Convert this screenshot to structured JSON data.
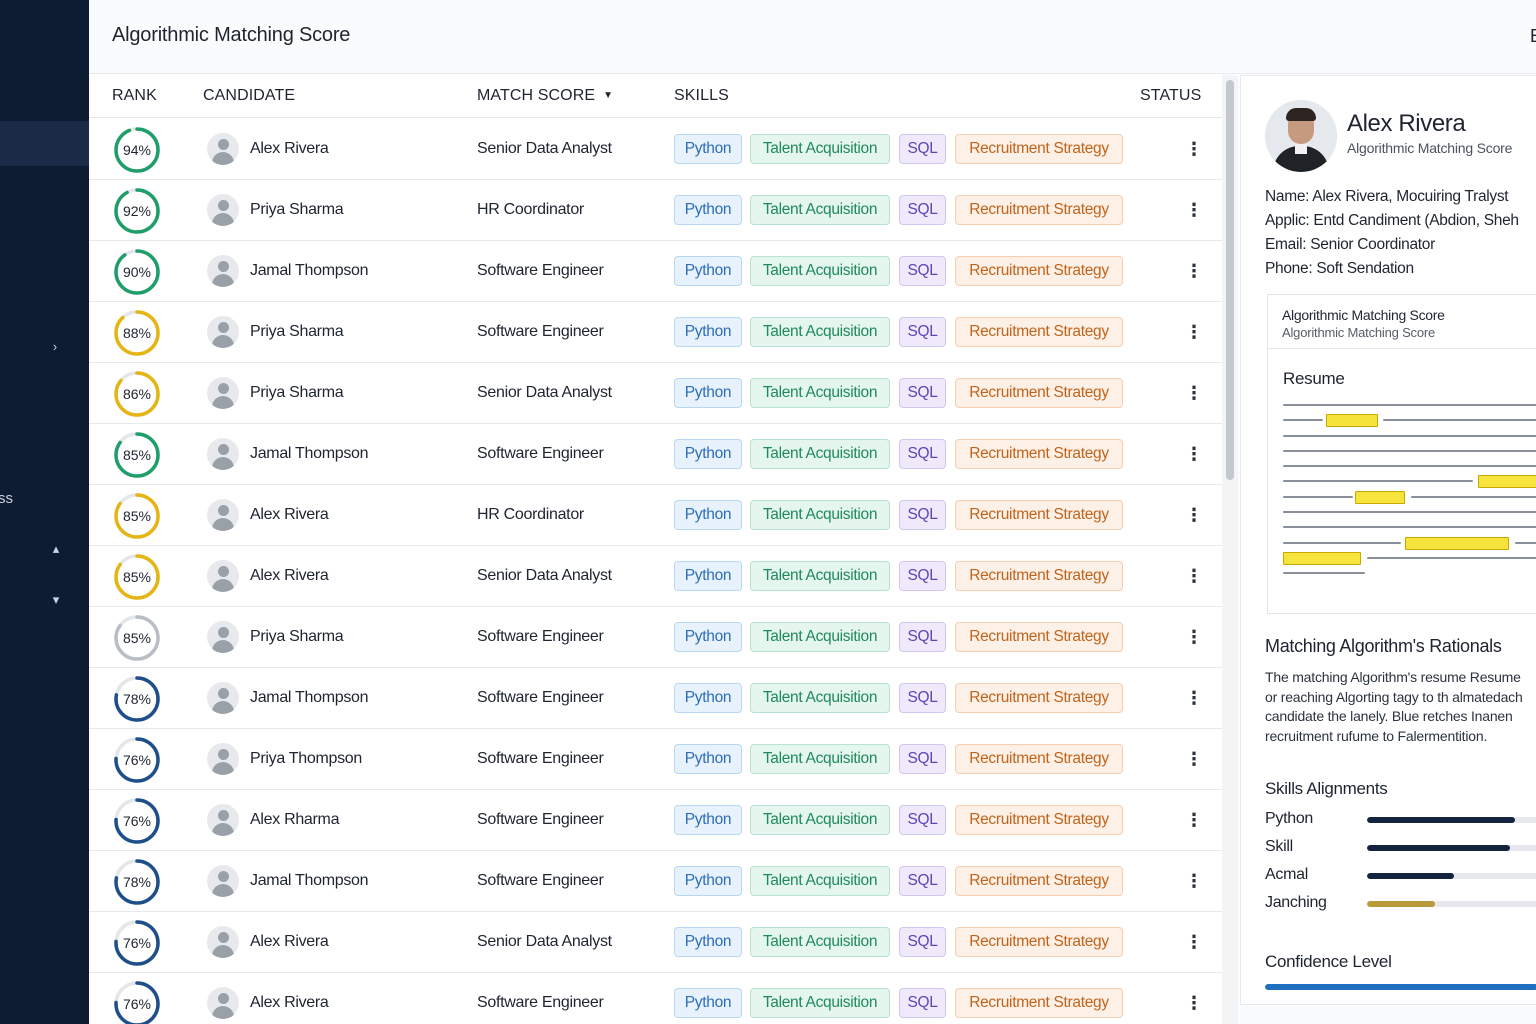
{
  "header": {
    "title": "Algorithmic Matching Score",
    "right_partial": "E"
  },
  "sidebar": {
    "partial_label": "ss",
    "chevron_right": "›",
    "chevron_up": "▴",
    "chevron_down": "▾"
  },
  "table": {
    "columns": {
      "rank": "RANK",
      "candidate": "CANDIDATE",
      "match_score": "MATCH SCORE",
      "skills": "SKILLS",
      "status": "STATUS"
    },
    "sort_icon": "▼",
    "skill_tags": [
      "Python",
      "Talent Acquisition",
      "SQL",
      "Recruitment Strategy"
    ],
    "rows": [
      {
        "score": 94,
        "score_label": "94%",
        "color": "#1f9e6a",
        "name": "Alex Rivera",
        "role": "Senior Data Analyst"
      },
      {
        "score": 92,
        "score_label": "92%",
        "color": "#1f9e6a",
        "name": "Priya Sharma",
        "role": "HR Coordinator"
      },
      {
        "score": 90,
        "score_label": "90%",
        "color": "#1f9e6a",
        "name": "Jamal Thompson",
        "role": "Software Engineer"
      },
      {
        "score": 88,
        "score_label": "88%",
        "color": "#e5b513",
        "name": "Priya Sharma",
        "role": "Software Engineer"
      },
      {
        "score": 86,
        "score_label": "86%",
        "color": "#e5b513",
        "name": "Priya Sharma",
        "role": "Senior Data Analyst"
      },
      {
        "score": 85,
        "score_label": "85%",
        "color": "#1f9e6a",
        "name": "Jamal Thompson",
        "role": "Software Engineer"
      },
      {
        "score": 85,
        "score_label": "85%",
        "color": "#e5b513",
        "name": "Alex Rivera",
        "role": "HR Coordinator"
      },
      {
        "score": 85,
        "score_label": "85%",
        "color": "#e5b513",
        "name": "Alex Rivera",
        "role": "Senior Data Analyst"
      },
      {
        "score": 85,
        "score_label": "85%",
        "color": "#b9bec6",
        "name": "Priya Sharma",
        "role": "Software Engineer"
      },
      {
        "score": 78,
        "score_label": "78%",
        "color": "#1e4f8a",
        "name": "Jamal Thompson",
        "role": "Software Engineer"
      },
      {
        "score": 76,
        "score_label": "76%",
        "color": "#1e4f8a",
        "name": "Priya Thompson",
        "role": "Software Engineer"
      },
      {
        "score": 76,
        "score_label": "76%",
        "color": "#1e4f8a",
        "name": "Alex Rharma",
        "role": "Software Engineer"
      },
      {
        "score": 78,
        "score_label": "78%",
        "color": "#1e4f8a",
        "name": "Jamal Thompson",
        "role": "Software Engineer"
      },
      {
        "score": 76,
        "score_label": "76%",
        "color": "#1e4f8a",
        "name": "Alex Rivera",
        "role": "Senior Data Analyst"
      },
      {
        "score": 76,
        "score_label": "76%",
        "color": "#1e4f8a",
        "name": "Alex Rivera",
        "role": "Software Engineer"
      }
    ]
  },
  "panel": {
    "name": "Alex Rivera",
    "subtitle": "Algorithmic Matching Score",
    "info": [
      "Name: Alex Rivera, Mocuiring Tralyst",
      "Applic: Entd Candiment (Abdion, Sheh",
      "Email: Senior Coordinator",
      "Phone: Soft Sendation"
    ],
    "box_title": "Algorithmic Matching Score",
    "box_subtitle": "Algorithmic Matching Score",
    "resume_title": "Resume",
    "rationale_title": "Matching Algorithm's Rationals",
    "rationale_lines": [
      "The matching Algorithm's resume Resume",
      "or reaching Algorting tagy to th almatedach",
      "candidate the lanely. Blue retches Inanen",
      "recruitment rufume to Falermentition."
    ],
    "skills_title": "Skills Alignments",
    "skills": [
      {
        "label": "Python",
        "value": 0.78,
        "color": "#14243f"
      },
      {
        "label": "Skill",
        "value": 0.75,
        "color": "#14243f"
      },
      {
        "label": "Acmal",
        "value": 0.46,
        "color": "#14243f"
      },
      {
        "label": "Janching",
        "value": 0.36,
        "color": "#b89a3a"
      }
    ],
    "confidence_title": "Confidence Level",
    "confidence": 0.94,
    "confidence_color": "#1f6fc0"
  }
}
